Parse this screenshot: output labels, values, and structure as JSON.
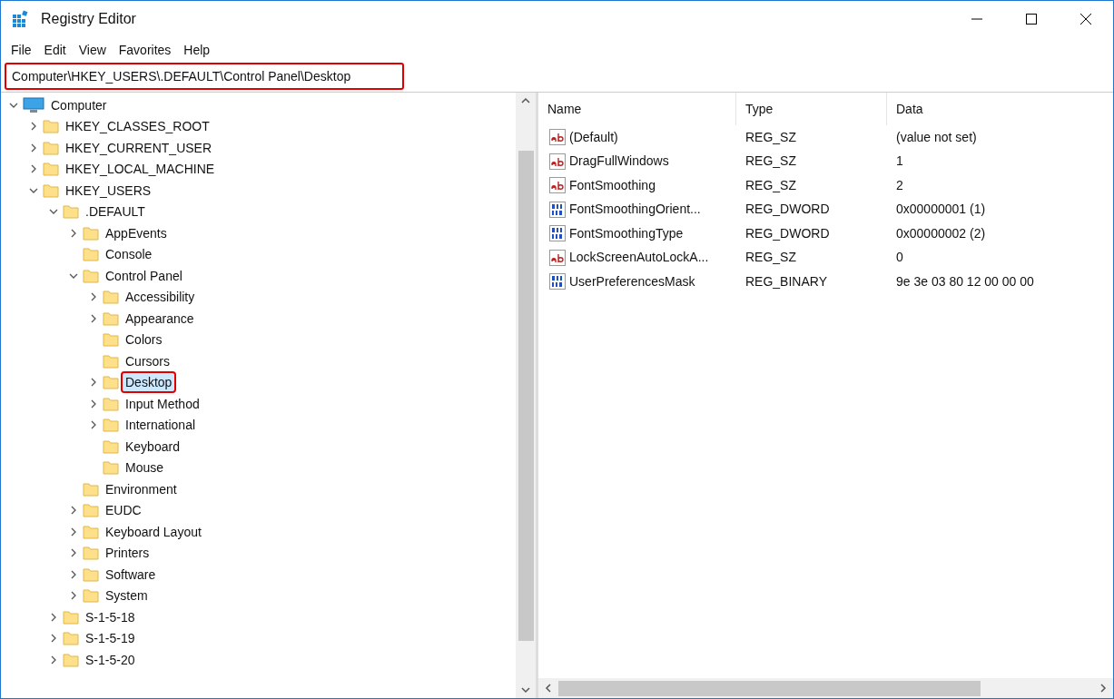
{
  "window": {
    "title": "Registry Editor"
  },
  "menu": [
    "File",
    "Edit",
    "View",
    "Favorites",
    "Help"
  ],
  "address_bar": {
    "value": "Computer\\HKEY_USERS\\.DEFAULT\\Control Panel\\Desktop",
    "highlighted": true
  },
  "tree": [
    {
      "label": "Computer",
      "kind": "computer",
      "expanded": true,
      "selected": false,
      "highlighted": false,
      "children": [
        {
          "label": "HKEY_CLASSES_ROOT",
          "kind": "folder",
          "expanded": false,
          "selected": false,
          "highlighted": false
        },
        {
          "label": "HKEY_CURRENT_USER",
          "kind": "folder",
          "expanded": false,
          "selected": false,
          "highlighted": false
        },
        {
          "label": "HKEY_LOCAL_MACHINE",
          "kind": "folder",
          "expanded": false,
          "selected": false,
          "highlighted": false
        },
        {
          "label": "HKEY_USERS",
          "kind": "folder",
          "expanded": true,
          "selected": false,
          "highlighted": false,
          "children": [
            {
              "label": ".DEFAULT",
              "kind": "folder",
              "expanded": true,
              "selected": false,
              "highlighted": false,
              "children": [
                {
                  "label": "AppEvents",
                  "kind": "folder",
                  "expanded": false,
                  "selected": false,
                  "highlighted": false
                },
                {
                  "label": "Console",
                  "kind": "folder",
                  "selected": false,
                  "highlighted": false
                },
                {
                  "label": "Control Panel",
                  "kind": "folder",
                  "expanded": true,
                  "selected": false,
                  "highlighted": false,
                  "children": [
                    {
                      "label": "Accessibility",
                      "kind": "folder",
                      "expanded": false,
                      "selected": false,
                      "highlighted": false
                    },
                    {
                      "label": "Appearance",
                      "kind": "folder",
                      "expanded": false,
                      "selected": false,
                      "highlighted": false
                    },
                    {
                      "label": "Colors",
                      "kind": "folder",
                      "selected": false,
                      "highlighted": false
                    },
                    {
                      "label": "Cursors",
                      "kind": "folder",
                      "selected": false,
                      "highlighted": false
                    },
                    {
                      "label": "Desktop",
                      "kind": "folder",
                      "expanded": false,
                      "selected": true,
                      "highlighted": true
                    },
                    {
                      "label": "Input Method",
                      "kind": "folder",
                      "expanded": false,
                      "selected": false,
                      "highlighted": false
                    },
                    {
                      "label": "International",
                      "kind": "folder",
                      "expanded": false,
                      "selected": false,
                      "highlighted": false
                    },
                    {
                      "label": "Keyboard",
                      "kind": "folder",
                      "selected": false,
                      "highlighted": false
                    },
                    {
                      "label": "Mouse",
                      "kind": "folder",
                      "selected": false,
                      "highlighted": false
                    }
                  ]
                },
                {
                  "label": "Environment",
                  "kind": "folder",
                  "selected": false,
                  "highlighted": false
                },
                {
                  "label": "EUDC",
                  "kind": "folder",
                  "expanded": false,
                  "selected": false,
                  "highlighted": false
                },
                {
                  "label": "Keyboard Layout",
                  "kind": "folder",
                  "expanded": false,
                  "selected": false,
                  "highlighted": false
                },
                {
                  "label": "Printers",
                  "kind": "folder",
                  "expanded": false,
                  "selected": false,
                  "highlighted": false
                },
                {
                  "label": "Software",
                  "kind": "folder",
                  "expanded": false,
                  "selected": false,
                  "highlighted": false
                },
                {
                  "label": "System",
                  "kind": "folder",
                  "expanded": false,
                  "selected": false,
                  "highlighted": false
                }
              ]
            },
            {
              "label": "S-1-5-18",
              "kind": "folder",
              "expanded": false,
              "selected": false,
              "highlighted": false
            },
            {
              "label": "S-1-5-19",
              "kind": "folder",
              "expanded": false,
              "selected": false,
              "highlighted": false
            },
            {
              "label": "S-1-5-20",
              "kind": "folder",
              "expanded": false,
              "selected": false,
              "highlighted": false
            }
          ]
        }
      ]
    }
  ],
  "table": {
    "columns": [
      "Name",
      "Type",
      "Data"
    ],
    "rows": [
      {
        "kind": "string",
        "name": "(Default)",
        "type": "REG_SZ",
        "data": "(value not set)"
      },
      {
        "kind": "string",
        "name": "DragFullWindows",
        "type": "REG_SZ",
        "data": "1"
      },
      {
        "kind": "string",
        "name": "FontSmoothing",
        "type": "REG_SZ",
        "data": "2"
      },
      {
        "kind": "binary",
        "name": "FontSmoothingOrient...",
        "type": "REG_DWORD",
        "data": "0x00000001 (1)"
      },
      {
        "kind": "binary",
        "name": "FontSmoothingType",
        "type": "REG_DWORD",
        "data": "0x00000002 (2)"
      },
      {
        "kind": "string",
        "name": "LockScreenAutoLockA...",
        "type": "REG_SZ",
        "data": "0"
      },
      {
        "kind": "binary",
        "name": "UserPreferencesMask",
        "type": "REG_BINARY",
        "data": "9e 3e 03 80 12 00 00 00"
      }
    ]
  }
}
